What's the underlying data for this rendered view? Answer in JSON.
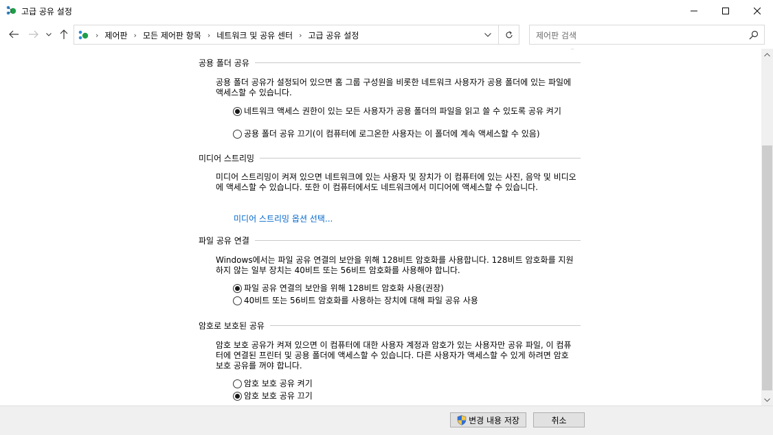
{
  "window": {
    "title": "고급 공유 설정"
  },
  "address": {
    "breadcrumbs": [
      "제어판",
      "모든 제어판 항목",
      "네트워크 및 공유 센터",
      "고급 공유 설정"
    ]
  },
  "search": {
    "placeholder": "제어판 검색"
  },
  "sections": {
    "public_folder": {
      "title": "공용 폴더 공유",
      "description": "공용 폴더 공유가 설정되어 있으면 홈 그룹 구성원을 비롯한 네트워크 사용자가 공용 폴더에 있는 파일에 액세스할 수 있습니다.",
      "option_on": "네트워크 액세스 권한이 있는 모든 사용자가 공용 폴더의 파일을 읽고 쓸 수 있도록 공유 켜기",
      "option_off": "공용 폴더 공유 끄기(이 컴퓨터에 로그온한 사용자는 이 폴더에 계속 액세스할 수 있음)",
      "selected": "on"
    },
    "media_streaming": {
      "title": "미디어 스트리밍",
      "description": "미디어 스트리밍이 켜져 있으면 네트워크에 있는 사용자 및 장치가 이 컴퓨터에 있는 사진, 음악 및 비디오에 액세스할 수 있습니다. 또한 이 컴퓨터에서도 네트워크에서 미디어에 액세스할 수 있습니다.",
      "link": "미디어 스트리밍 옵션 선택..."
    },
    "file_sharing": {
      "title": "파일 공유 연결",
      "description": "Windows에서는 파일 공유 연결의 보안을 위해 128비트 암호화를 사용합니다. 128비트 암호화를 지원하지 않는 일부 장치는 40비트 또는 56비트 암호화를 사용해야 합니다.",
      "option_128": "파일 공유 연결의 보안을 위해 128비트 암호화 사용(권장)",
      "option_40_56": "40비트 또는 56비트 암호화를 사용하는 장치에 대해 파일 공유 사용",
      "selected": "128"
    },
    "password_protected": {
      "title": "암호로 보호된 공유",
      "description": "암호 보호 공유가 켜져 있으면 이 컴퓨터에 대한 사용자 계정과 암호가 있는 사용자만 공유 파일, 이 컴퓨터에 연결된 프린터 및 공용 폴더에 액세스할 수 있습니다. 다른 사용자가 액세스할 수 있게 하려면 암호 보호 공유를 꺼야 합니다.",
      "option_on": "암호 보호 공유 켜기",
      "option_off": "암호 보호 공유 끄기",
      "selected": "off"
    }
  },
  "buttons": {
    "save": "변경 내용 저장",
    "cancel": "취소"
  },
  "colors": {
    "link": "#0066cc",
    "bottom_bar": "#f0f0f0",
    "scroll_thumb": "#cdcdcd"
  }
}
